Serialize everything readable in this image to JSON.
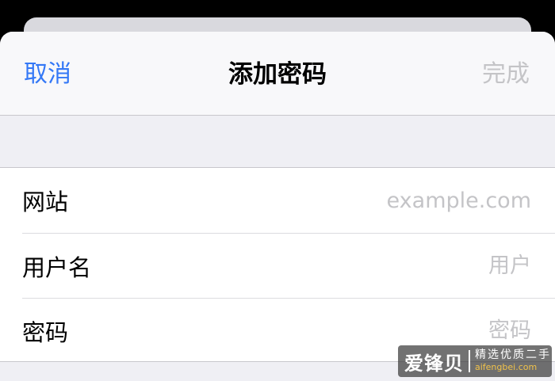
{
  "nav": {
    "cancel_label": "取消",
    "title": "添加密码",
    "done_label": "完成"
  },
  "form": {
    "rows": [
      {
        "label": "网站",
        "placeholder": "example.com",
        "value": ""
      },
      {
        "label": "用户名",
        "placeholder": "用户",
        "value": ""
      },
      {
        "label": "密码",
        "placeholder": "密码",
        "value": ""
      }
    ]
  },
  "watermark": {
    "brand": "爱锋贝",
    "slogan": "精选优质二手",
    "url": "aifengbei.com"
  },
  "colors": {
    "accent": "#3478f6",
    "disabled": "#c4c4c7",
    "background": "#efeff4"
  }
}
